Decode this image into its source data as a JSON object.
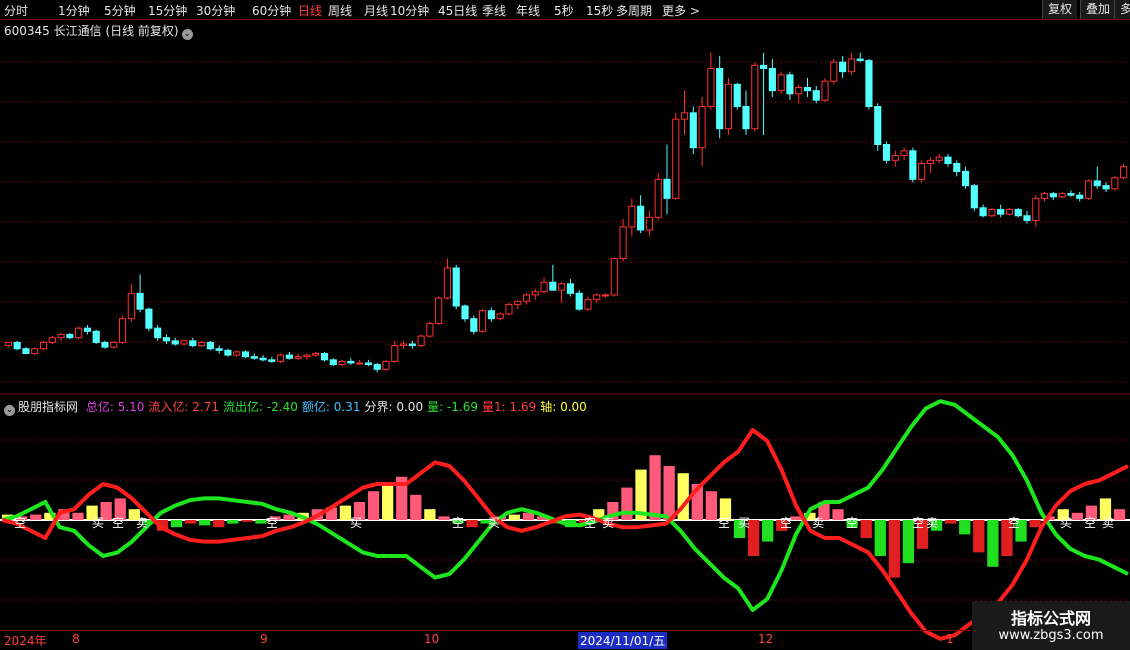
{
  "toolbar": {
    "periods": [
      "分时",
      "1分钟",
      "5分钟",
      "15分钟",
      "30分钟",
      "60分钟",
      "日线",
      "周线",
      "月线",
      "10分钟",
      "45日线",
      "季线",
      "年线",
      "5秒",
      "15秒",
      "多周期",
      "更多 >"
    ],
    "active_period": "日线",
    "buttons": [
      "复权",
      "叠加",
      "多"
    ]
  },
  "header": {
    "stock": "600345 长江通信 (日线 前复权)"
  },
  "indicator_row": {
    "name": "股朋指标网",
    "items": [
      {
        "label": "总亿: 5.10",
        "color": "#e040e0"
      },
      {
        "label": "流入亿: 2.71",
        "color": "#ff4040"
      },
      {
        "label": "流出亿: -2.40",
        "color": "#30e030"
      },
      {
        "label": "额亿: 0.31",
        "color": "#40c0ff"
      },
      {
        "label": "分界: 0.00",
        "color": "#e6e6e6"
      },
      {
        "label": "量: -1.69",
        "color": "#30e030"
      },
      {
        "label": "量1: 1.69",
        "color": "#ff4040"
      },
      {
        "label": "轴: 0.00",
        "color": "#ffff30"
      }
    ]
  },
  "date_axis": {
    "labels": [
      "2024年",
      "8",
      "9",
      "10",
      "2024/11/01/五",
      "12",
      "1"
    ],
    "selected": "2024/11/01/五"
  },
  "signal_labels": [
    "空",
    "买",
    "空",
    "卖",
    "空",
    "买",
    "空",
    "买",
    "空",
    "卖",
    "空",
    "买",
    "空",
    "卖",
    "空",
    "空",
    "卖",
    "空",
    "买",
    "空",
    "卖"
  ],
  "watermark": {
    "title": "指标公式网",
    "url": "www.zbgs3.com"
  },
  "colors": {
    "up": "#ff3030",
    "down": "#54ffff",
    "inflow": "#ff1e1e",
    "outflow": "#1ee61e",
    "grid": "#7a0000"
  },
  "chart_data": {
    "type": "candlestick",
    "candles": [
      [
        10.95,
        11.05,
        10.9,
        11.05
      ],
      [
        11.05,
        11.1,
        10.8,
        10.85
      ],
      [
        10.85,
        10.9,
        10.7,
        10.7
      ],
      [
        10.7,
        10.9,
        10.65,
        10.85
      ],
      [
        10.85,
        11.1,
        10.8,
        11.05
      ],
      [
        11.05,
        11.25,
        11.0,
        11.2
      ],
      [
        11.2,
        11.35,
        11.1,
        11.3
      ],
      [
        11.3,
        11.35,
        11.15,
        11.2
      ],
      [
        11.2,
        11.55,
        11.15,
        11.5
      ],
      [
        11.5,
        11.6,
        11.3,
        11.4
      ],
      [
        11.4,
        11.45,
        11.0,
        11.05
      ],
      [
        11.05,
        11.1,
        10.85,
        10.9
      ],
      [
        10.9,
        11.1,
        10.85,
        11.05
      ],
      [
        11.05,
        11.9,
        11.0,
        11.8
      ],
      [
        11.8,
        12.9,
        11.7,
        12.6
      ],
      [
        12.6,
        13.2,
        12.0,
        12.1
      ],
      [
        12.1,
        12.15,
        11.4,
        11.5
      ],
      [
        11.5,
        11.6,
        11.1,
        11.2
      ],
      [
        11.2,
        11.3,
        11.0,
        11.1
      ],
      [
        11.1,
        11.2,
        10.95,
        11.0
      ],
      [
        11.0,
        11.15,
        10.95,
        11.1
      ],
      [
        11.1,
        11.2,
        10.9,
        10.95
      ],
      [
        10.95,
        11.1,
        10.9,
        11.05
      ],
      [
        11.05,
        11.1,
        10.8,
        10.85
      ],
      [
        10.85,
        10.95,
        10.7,
        10.8
      ],
      [
        10.8,
        10.85,
        10.6,
        10.65
      ],
      [
        10.65,
        10.8,
        10.6,
        10.75
      ],
      [
        10.75,
        10.8,
        10.55,
        10.6
      ],
      [
        10.6,
        10.7,
        10.5,
        10.55
      ],
      [
        10.55,
        10.65,
        10.45,
        10.5
      ],
      [
        10.5,
        10.6,
        10.4,
        10.45
      ],
      [
        10.45,
        10.7,
        10.4,
        10.65
      ],
      [
        10.65,
        10.75,
        10.5,
        10.55
      ],
      [
        10.55,
        10.7,
        10.5,
        10.6
      ],
      [
        10.6,
        10.7,
        10.5,
        10.65
      ],
      [
        10.65,
        10.75,
        10.6,
        10.7
      ],
      [
        10.7,
        10.75,
        10.45,
        10.5
      ],
      [
        10.5,
        10.55,
        10.3,
        10.35
      ],
      [
        10.35,
        10.5,
        10.3,
        10.45
      ],
      [
        10.45,
        10.55,
        10.35,
        10.4
      ],
      [
        10.4,
        10.5,
        10.35,
        10.4
      ],
      [
        10.4,
        10.5,
        10.3,
        10.35
      ],
      [
        10.35,
        10.4,
        10.1,
        10.2
      ],
      [
        10.2,
        10.5,
        10.15,
        10.45
      ],
      [
        10.45,
        11.1,
        10.4,
        10.95
      ],
      [
        10.95,
        11.1,
        10.85,
        11.0
      ],
      [
        11.0,
        11.1,
        10.85,
        10.95
      ],
      [
        10.95,
        11.3,
        10.9,
        11.25
      ],
      [
        11.25,
        11.7,
        11.2,
        11.65
      ],
      [
        11.65,
        12.5,
        11.6,
        12.45
      ],
      [
        12.45,
        13.7,
        12.4,
        13.4
      ],
      [
        13.4,
        13.5,
        12.1,
        12.2
      ],
      [
        12.2,
        12.25,
        11.7,
        11.8
      ],
      [
        11.8,
        11.9,
        11.3,
        11.4
      ],
      [
        11.4,
        12.1,
        11.35,
        12.05
      ],
      [
        12.05,
        12.15,
        11.7,
        11.8
      ],
      [
        11.8,
        12.0,
        11.75,
        11.95
      ],
      [
        11.95,
        12.3,
        11.9,
        12.25
      ],
      [
        12.25,
        12.4,
        12.1,
        12.35
      ],
      [
        12.35,
        12.6,
        12.25,
        12.55
      ],
      [
        12.55,
        12.75,
        12.4,
        12.65
      ],
      [
        12.65,
        13.1,
        12.6,
        12.95
      ],
      [
        12.95,
        13.5,
        12.85,
        12.7
      ],
      [
        12.7,
        12.95,
        12.3,
        12.9
      ],
      [
        12.9,
        13.05,
        12.5,
        12.6
      ],
      [
        12.6,
        12.7,
        12.05,
        12.1
      ],
      [
        12.1,
        12.5,
        12.05,
        12.4
      ],
      [
        12.4,
        12.6,
        12.3,
        12.55
      ],
      [
        12.55,
        12.6,
        12.45,
        12.55
      ],
      [
        12.55,
        13.75,
        12.5,
        13.7
      ],
      [
        13.7,
        14.95,
        13.6,
        14.7
      ],
      [
        14.7,
        15.6,
        14.4,
        15.35
      ],
      [
        15.35,
        15.7,
        14.5,
        14.6
      ],
      [
        14.6,
        15.2,
        14.4,
        15.0
      ],
      [
        15.0,
        16.4,
        14.9,
        16.2
      ],
      [
        16.2,
        17.3,
        15.1,
        15.6
      ],
      [
        15.6,
        18.3,
        15.55,
        18.1
      ],
      [
        18.1,
        19.0,
        17.6,
        18.3
      ],
      [
        18.3,
        18.5,
        17.0,
        17.2
      ],
      [
        17.2,
        18.8,
        16.6,
        18.5
      ],
      [
        18.5,
        20.2,
        18.4,
        19.7
      ],
      [
        19.7,
        20.1,
        17.5,
        17.8
      ],
      [
        17.8,
        19.4,
        17.6,
        19.2
      ],
      [
        19.2,
        19.25,
        18.4,
        18.5
      ],
      [
        18.5,
        19.0,
        17.6,
        17.8
      ],
      [
        17.8,
        19.9,
        17.7,
        19.8
      ],
      [
        19.8,
        20.2,
        17.6,
        19.7
      ],
      [
        19.7,
        20.0,
        18.8,
        19.0
      ],
      [
        19.0,
        19.6,
        18.9,
        19.5
      ],
      [
        19.5,
        19.6,
        18.7,
        18.9
      ],
      [
        18.9,
        19.2,
        18.6,
        19.1
      ],
      [
        19.1,
        19.4,
        18.8,
        19.0
      ],
      [
        19.0,
        19.15,
        18.6,
        18.7
      ],
      [
        18.7,
        19.4,
        18.65,
        19.3
      ],
      [
        19.3,
        20.0,
        19.2,
        19.9
      ],
      [
        19.9,
        20.1,
        19.4,
        19.6
      ],
      [
        19.6,
        20.2,
        19.5,
        20.0
      ],
      [
        20.0,
        20.2,
        19.9,
        19.95
      ],
      [
        19.95,
        20.0,
        18.4,
        18.5
      ],
      [
        18.5,
        18.6,
        17.1,
        17.3
      ],
      [
        17.3,
        17.4,
        16.7,
        16.8
      ],
      [
        16.8,
        17.1,
        16.6,
        16.95
      ],
      [
        16.95,
        17.2,
        16.8,
        17.1
      ],
      [
        17.1,
        17.2,
        16.1,
        16.2
      ],
      [
        16.2,
        16.8,
        16.1,
        16.7
      ],
      [
        16.7,
        16.9,
        16.4,
        16.8
      ],
      [
        16.8,
        17.0,
        16.7,
        16.9
      ],
      [
        16.9,
        17.0,
        16.6,
        16.7
      ],
      [
        16.7,
        16.8,
        16.3,
        16.45
      ],
      [
        16.45,
        16.6,
        15.9,
        16.0
      ],
      [
        16.0,
        16.05,
        15.2,
        15.3
      ],
      [
        15.3,
        15.4,
        15.0,
        15.05
      ],
      [
        15.05,
        15.3,
        15.0,
        15.25
      ],
      [
        15.25,
        15.4,
        15.0,
        15.1
      ],
      [
        15.1,
        15.3,
        15.05,
        15.25
      ],
      [
        15.25,
        15.3,
        15.0,
        15.05
      ],
      [
        15.05,
        15.2,
        14.8,
        14.9
      ],
      [
        14.9,
        15.7,
        14.7,
        15.6
      ],
      [
        15.6,
        15.8,
        15.5,
        15.75
      ],
      [
        15.75,
        15.8,
        15.55,
        15.65
      ],
      [
        15.65,
        15.8,
        15.6,
        15.75
      ],
      [
        15.75,
        15.85,
        15.65,
        15.7
      ],
      [
        15.7,
        15.8,
        15.5,
        15.6
      ],
      [
        15.6,
        16.2,
        15.55,
        16.15
      ],
      [
        16.15,
        16.6,
        15.9,
        16.0
      ],
      [
        16.0,
        16.1,
        15.8,
        15.9
      ],
      [
        15.9,
        16.3,
        15.85,
        16.25
      ],
      [
        16.25,
        16.7,
        16.2,
        16.6
      ]
    ],
    "flow": {
      "inflow_curve": [
        0,
        -0.1,
        -0.3,
        -0.5,
        0.2,
        0.3,
        0.7,
        1.0,
        0.9,
        0.6,
        0.2,
        -0.2,
        -0.4,
        -0.55,
        -0.6,
        -0.6,
        -0.55,
        -0.5,
        -0.45,
        -0.3,
        -0.2,
        -0.05,
        0.15,
        0.4,
        0.65,
        0.9,
        1.0,
        1.0,
        1.0,
        1.3,
        1.6,
        1.5,
        1.1,
        0.6,
        0.1,
        -0.2,
        -0.3,
        -0.2,
        -0.05,
        0.1,
        0.15,
        0.05,
        -0.1,
        -0.2,
        -0.2,
        -0.15,
        -0.1,
        0.3,
        0.8,
        1.2,
        1.6,
        1.9,
        2.5,
        2.2,
        1.4,
        0.4,
        -0.3,
        -0.5,
        -0.5,
        -0.7,
        -0.9,
        -1.4,
        -2.0,
        -2.6,
        -3.1,
        -3.3,
        -3.2,
        -2.9,
        -2.6,
        -2.3,
        -1.8,
        -1.1,
        -0.2,
        0.4,
        0.8,
        1.0,
        1.1,
        1.3,
        1.5
      ],
      "bars": [
        0.15,
        0.1,
        0.15,
        0.2,
        0.3,
        0.2,
        0.4,
        0.5,
        0.6,
        0.3,
        -0.1,
        -0.3,
        -0.2,
        -0.1,
        -0.15,
        -0.2,
        -0.1,
        -0.05,
        -0.1,
        0.1,
        0.15,
        0.2,
        0.3,
        0.35,
        0.4,
        0.5,
        0.8,
        1.0,
        1.2,
        0.7,
        0.3,
        0.1,
        -0.1,
        -0.2,
        -0.1,
        0.1,
        0.15,
        0.2,
        0.1,
        -0.1,
        -0.2,
        -0.1,
        0.3,
        0.5,
        0.9,
        1.4,
        1.8,
        1.5,
        1.3,
        1.0,
        0.8,
        0.6,
        -0.5,
        -1.0,
        -0.6,
        -0.3,
        0.1,
        0.2,
        0.5,
        0.3,
        -0.2,
        -0.5,
        -1.0,
        -1.6,
        -1.2,
        -0.8,
        -0.3,
        -0.1,
        -0.4,
        -0.9,
        -1.3,
        -1.0,
        -0.6,
        -0.2,
        0.1,
        0.3,
        0.2,
        0.4,
        0.6,
        0.3
      ]
    }
  }
}
